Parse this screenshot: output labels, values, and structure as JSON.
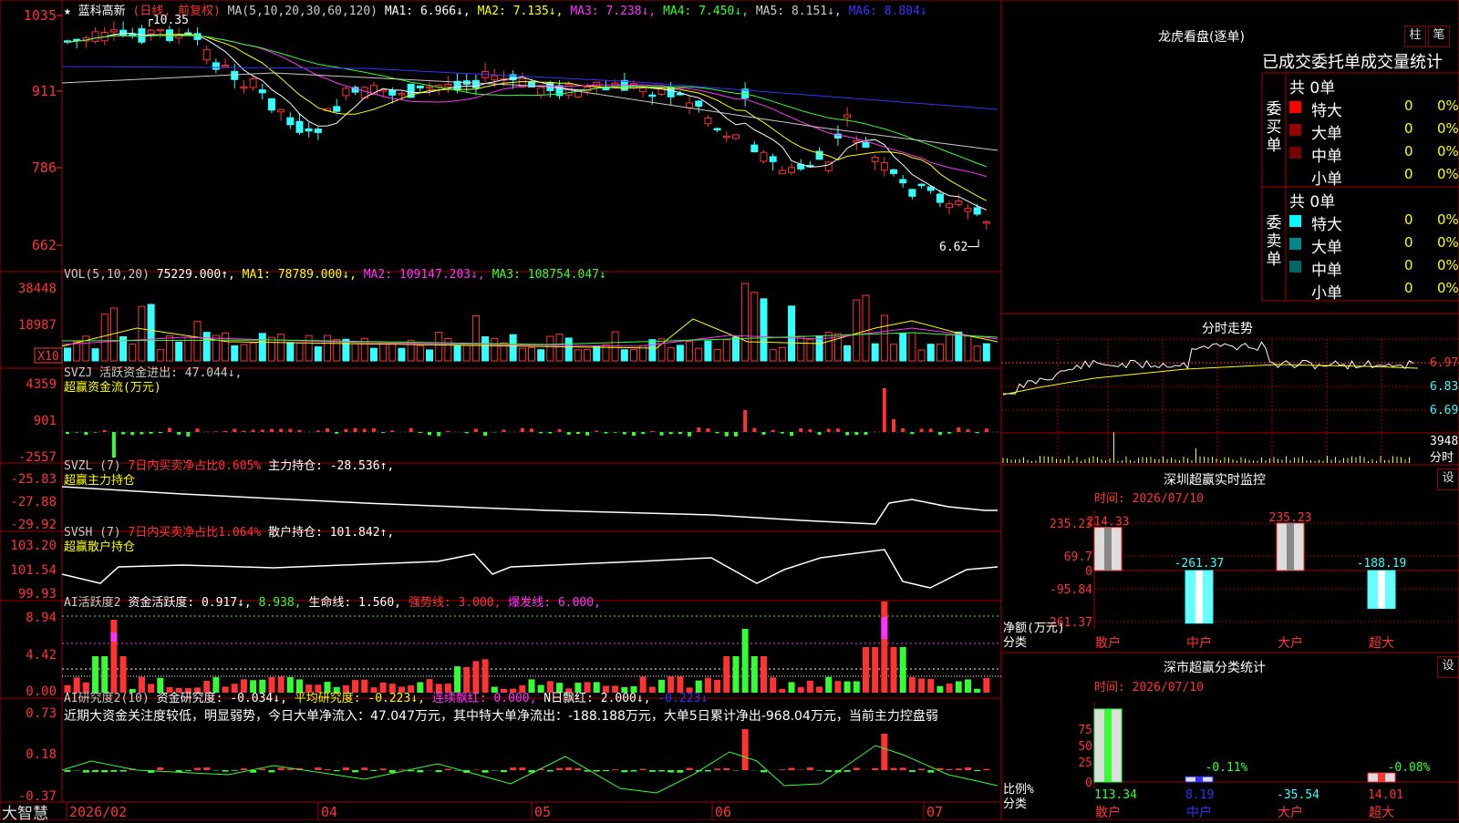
{
  "app": {
    "name": "大智慧"
  },
  "stock": {
    "name": "蓝科高新",
    "mode": "(日线, 前复权)",
    "high_label": "10.35",
    "low_label": "6.62"
  },
  "colors": {
    "up": "#ff3333",
    "down": "#33ffff",
    "ma1": "#ffffff",
    "ma2": "#ffff00",
    "ma3": "#ff33ff",
    "ma4": "#33ff33",
    "ma5": "#cccccc",
    "ma6": "#3333ff",
    "grid": "#880000"
  },
  "main_panel": {
    "axis_labels": [
      "1035",
      "911",
      "786",
      "662"
    ],
    "legend": [
      {
        "text": "MA(5,10,20,30,60,120)",
        "color": "#cccccc"
      },
      {
        "text": "MA1: 6.966↓,",
        "color": "#ffffff"
      },
      {
        "text": "MA2: 7.135↓,",
        "color": "#ffff00"
      },
      {
        "text": "MA3: 7.238↓,",
        "color": "#ff33ff"
      },
      {
        "text": "MA4: 7.450↓,",
        "color": "#33ff33"
      },
      {
        "text": "MA5: 8.151↓,",
        "color": "#cccccc"
      },
      {
        "text": "MA6: 8.804↓",
        "color": "#3333ff"
      }
    ]
  },
  "vol_panel": {
    "axis_labels": [
      "38448",
      "18987"
    ],
    "unit": "X10",
    "legend": [
      {
        "text": "VOL(5,10,20)",
        "color": "#cccccc"
      },
      {
        "text": "75229.000↑,",
        "color": "#ffffff"
      },
      {
        "text": "MA1: 78789.000↓,",
        "color": "#ffff00"
      },
      {
        "text": "MA2: 109147.203↓,",
        "color": "#ff33ff"
      },
      {
        "text": "MA3: 108754.047↓",
        "color": "#33ff33"
      }
    ]
  },
  "svzj_panel": {
    "axis_labels": [
      "4359",
      "901",
      "-2557"
    ],
    "legend1": [
      {
        "text": "SVZJ 活跃资金进出: 47.044↓,",
        "color": "#cccccc"
      }
    ],
    "legend2": [
      {
        "text": "超赢资金流(万元)",
        "color": "#ffff00"
      }
    ]
  },
  "svzl_panel": {
    "axis_labels": [
      "-25.83",
      "-27.88",
      "-29.92"
    ],
    "legend1": [
      {
        "text": "SVZL (7)",
        "color": "#cccccc"
      },
      {
        "text": "7日内买卖净占比0.605%",
        "color": "#ff3333"
      },
      {
        "text": "主力持仓: -28.536↑,",
        "color": "#ffffff"
      }
    ],
    "legend2": [
      {
        "text": "超赢主力持仓",
        "color": "#ffff00"
      }
    ]
  },
  "svsh_panel": {
    "axis_labels": [
      "103.20",
      "101.54",
      "99.93"
    ],
    "legend1": [
      {
        "text": "SVSH (7)",
        "color": "#cccccc"
      },
      {
        "text": "7日内买卖净占比1.064%",
        "color": "#ff3333"
      },
      {
        "text": "散户持仓: 101.842↑,",
        "color": "#ffffff"
      }
    ],
    "legend2": [
      {
        "text": "超赢散户持仓",
        "color": "#ffff00"
      }
    ]
  },
  "ai_active_panel": {
    "axis_labels": [
      "8.94",
      "4.42",
      "0.00"
    ],
    "legend1": [
      {
        "text": "AI活跃度2",
        "color": "#cccccc"
      },
      {
        "text": "资金活跃度: 0.917↓,",
        "color": "#ffffff"
      },
      {
        "text": "8.938,",
        "color": "#33ff33"
      },
      {
        "text": "生命线: 1.560,",
        "color": "#ffffff"
      },
      {
        "text": "强势线: 3.000,",
        "color": "#ff3333"
      },
      {
        "text": "爆发线: 6.000,",
        "color": "#ff33ff"
      }
    ]
  },
  "ai_research_panel": {
    "axis_labels": [
      "0.73",
      "0.18",
      "-0.37"
    ],
    "legend1": [
      {
        "text": "AI研究度2(10)",
        "color": "#cccccc"
      },
      {
        "text": "资金研究度: -0.034↓,",
        "color": "#ffffff"
      },
      {
        "text": "平均研究度: -0.223↓,",
        "color": "#ffff00"
      },
      {
        "text": "连续飘红: 0.000,",
        "color": "#ff33ff"
      },
      {
        "text": "N日飘红: 2.000↓,",
        "color": "#ffffff"
      },
      {
        "text": "-0.223↓",
        "color": "#3333ff"
      }
    ],
    "comment": "近期大资金关注度较低，明显弱势，今日大单净流入：47.047万元，其中特大单净流出：-188.188万元，大单5日累计净出-968.04万元，当前主力控盘弱"
  },
  "x_axis": {
    "labels": [
      "2026/02",
      "04",
      "05",
      "06",
      "07"
    ]
  },
  "dragon_tiger": {
    "title": "龙虎看盘(逐单)",
    "btn1": "柱",
    "btn2": "笔",
    "subtitle": "已成交委托单成交量统计",
    "buy_side": "委买单",
    "sell_side": "委卖单",
    "buy_total": "共 0单",
    "sell_total": "共 0单",
    "buy_rows": [
      {
        "label": "特大",
        "count": "0",
        "pct": "0%",
        "color": "#ff0000"
      },
      {
        "label": "大单",
        "count": "0",
        "pct": "0%",
        "color": "#990000"
      },
      {
        "label": "中单",
        "count": "0",
        "pct": "0%",
        "color": "#770000"
      },
      {
        "label": "小单",
        "count": "0",
        "pct": "0%",
        "color": ""
      }
    ],
    "sell_rows": [
      {
        "label": "特大",
        "count": "0",
        "pct": "0%",
        "color": "#00ffff"
      },
      {
        "label": "大单",
        "count": "0",
        "pct": "0%",
        "color": "#008888"
      },
      {
        "label": "中单",
        "count": "0",
        "pct": "0%",
        "color": "#006666"
      },
      {
        "label": "小单",
        "count": "0",
        "pct": "0%",
        "color": ""
      }
    ]
  },
  "intraday": {
    "title": "分时走势",
    "labels": [
      "6.97",
      "6.83",
      "6.69",
      "3948"
    ],
    "vol_unit": "分时"
  },
  "realtime": {
    "title": "深圳超赢实时监控",
    "btn": "设",
    "time": "时间: 2026/07/10",
    "axis": [
      "235.23",
      "69.7",
      "0",
      "-95.84",
      "-261.37"
    ],
    "axis_caption1": "净额(万元)",
    "axis_caption2": "分类",
    "bars": [
      {
        "label": "散户",
        "value": 214.33,
        "value_text": "214.33"
      },
      {
        "label": "中户",
        "value": -261.37,
        "value_text": "-261.37"
      },
      {
        "label": "大户",
        "value": 235.23,
        "value_text": "235.23"
      },
      {
        "label": "超大",
        "value": -188.19,
        "value_text": "-188.19"
      }
    ]
  },
  "category": {
    "title": "深市超赢分类统计",
    "btn": "设",
    "time": "时间: 2026/07/10",
    "axis": [
      "75",
      "50",
      "25",
      "0"
    ],
    "axis_caption1": "比例%",
    "axis_caption2": "分类",
    "bars": [
      {
        "label": "散户",
        "value": 113.34,
        "value_text": "113.34",
        "pct_text": ""
      },
      {
        "label": "中户",
        "value": 8.19,
        "value_text": "8.19",
        "pct_text": "-0.11%"
      },
      {
        "label": "大户",
        "value": -35.54,
        "value_text": "-35.54",
        "pct_text": ""
      },
      {
        "label": "超大",
        "value": 14.01,
        "value_text": "14.01",
        "pct_text": "-0.08%"
      }
    ]
  }
}
